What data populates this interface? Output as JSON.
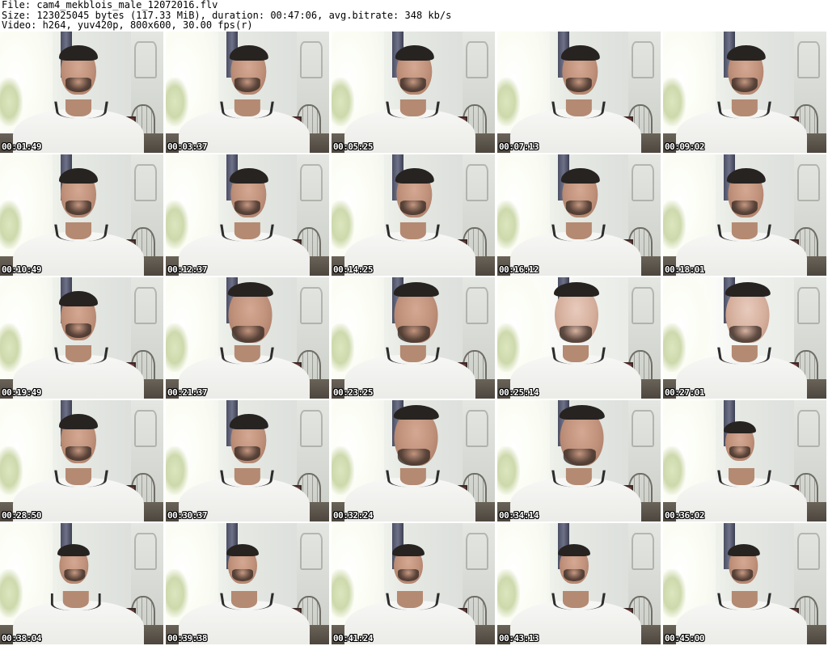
{
  "header": {
    "file_line": "File: cam4_mekblois_male_12072016.flv",
    "size_line": "Size: 123025045 bytes (117.33 MiB), duration: 00:47:06, avg.bitrate: 348 kb/s",
    "video_line": "Video: h264, yuv420p, 800x600, 30.00 fps(r)"
  },
  "thumbnails": [
    {
      "timestamp": "00:01:49"
    },
    {
      "timestamp": "00:03:37"
    },
    {
      "timestamp": "00:05:25"
    },
    {
      "timestamp": "00:07:13"
    },
    {
      "timestamp": "00:09:02"
    },
    {
      "timestamp": "00:10:49"
    },
    {
      "timestamp": "00:12:37"
    },
    {
      "timestamp": "00:14:25"
    },
    {
      "timestamp": "00:16:12"
    },
    {
      "timestamp": "00:18:01"
    },
    {
      "timestamp": "00:19:49"
    },
    {
      "timestamp": "00:21:37"
    },
    {
      "timestamp": "00:23:25"
    },
    {
      "timestamp": "00:25:14"
    },
    {
      "timestamp": "00:27:01"
    },
    {
      "timestamp": "00:28:50"
    },
    {
      "timestamp": "00:30:37"
    },
    {
      "timestamp": "00:32:24"
    },
    {
      "timestamp": "00:34:14"
    },
    {
      "timestamp": "00:36:02"
    },
    {
      "timestamp": "00:38:04"
    },
    {
      "timestamp": "00:39:38"
    },
    {
      "timestamp": "00:41:24"
    },
    {
      "timestamp": "00:43:13"
    },
    {
      "timestamp": "00:45:00"
    }
  ]
}
